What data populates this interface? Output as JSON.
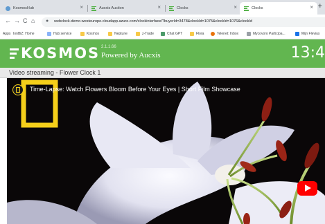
{
  "browser": {
    "tabs": [
      {
        "label": "KosmosHub",
        "active": false
      },
      {
        "label": "Auxxis Auction",
        "active": false
      },
      {
        "label": "Clocks",
        "active": false
      },
      {
        "label": "Clocks",
        "active": true
      }
    ],
    "new_tab": "+",
    "close_glyph": "×",
    "nav": {
      "back": "←",
      "forward": "→",
      "reload": "C",
      "home": "⌂"
    },
    "url": "webclock-demo.westeurope.cloudapp.azure.com/clockinterface/?buyerId=3478&clockId=1075&clockId=1076&clockId",
    "bookmarks": [
      "Apps",
      "IonBiZ: Home",
      "Hub service",
      "Kosmos",
      "Neptune",
      "z-Trade",
      "Chat GPT",
      "Flora",
      "Telenet: Inbox",
      "Mycovoro Participa...",
      "Mijn Flevius"
    ]
  },
  "kosmos": {
    "logo_text": "KOSMOS",
    "version": "2.1.1.66",
    "powered_by": "Powered by Aucxis",
    "clock_time": "13:4",
    "colors": {
      "header": "#62b650",
      "video_bg": "#0a0708",
      "youtube": "#ff0000",
      "brand_yellow": "#f5cf1a"
    }
  },
  "page": {
    "title": "Video streaming - Flower Clock 1"
  },
  "video": {
    "title": "Time-Lapse: Watch Flowers Bloom Before Your Eyes | Short Film Showcase"
  }
}
